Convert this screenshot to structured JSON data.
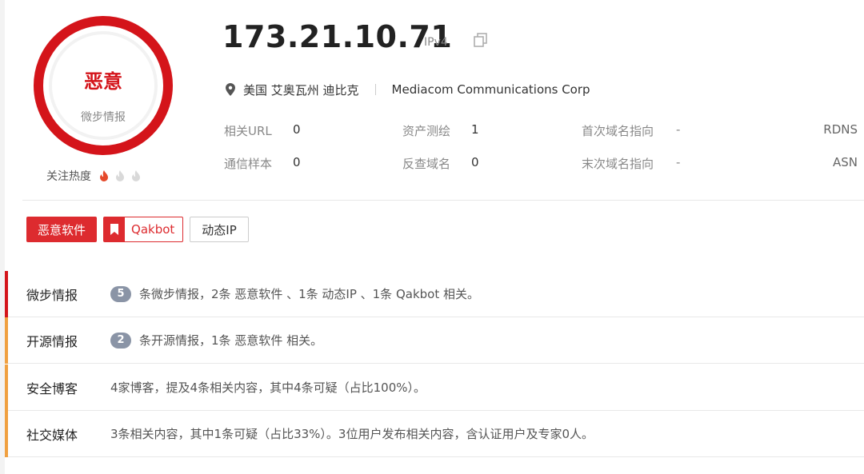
{
  "verdict": {
    "label": "恶意",
    "source": "微步情报",
    "color": "#d4141a"
  },
  "heat": {
    "label": "关注热度",
    "level": 1,
    "max": 3
  },
  "ip": {
    "address": "173.21.10.71",
    "version": "IPv4"
  },
  "location": {
    "place": "美国 艾奥瓦州 迪比克",
    "org": "Mediacom Communications Corp"
  },
  "meta": [
    {
      "label": "相关URL",
      "value": "0"
    },
    {
      "label": "资产测绘",
      "value": "1"
    },
    {
      "label": "首次域名指向",
      "value": "-"
    },
    {
      "label": "通信样本",
      "value": "0"
    },
    {
      "label": "反查域名",
      "value": "0"
    },
    {
      "label": "末次域名指向",
      "value": "-"
    }
  ],
  "meta_right": [
    "RDNS",
    "ASN"
  ],
  "tags": {
    "malware": "恶意软件",
    "family": "Qakbot",
    "dynamic": "动态IP"
  },
  "intel": [
    {
      "label": "微步情报",
      "badge": "5",
      "text": "条微步情报，2条 恶意软件 、1条 动态IP 、1条 Qakbot 相关。",
      "color": "#d4141a"
    },
    {
      "label": "开源情报",
      "badge": "2",
      "text": "条开源情报，1条 恶意软件 相关。",
      "color": "#f0a040"
    },
    {
      "label": "安全博客",
      "badge": "",
      "text": "4家博客，提及4条相关内容，其中4条可疑（占比100%）。",
      "color": "#f0a040"
    },
    {
      "label": "社交媒体",
      "badge": "",
      "text": "3条相关内容，其中1条可疑（占比33%）。3位用户发布相关内容，含认证用户及专家0人。",
      "color": "#f0a040"
    }
  ]
}
